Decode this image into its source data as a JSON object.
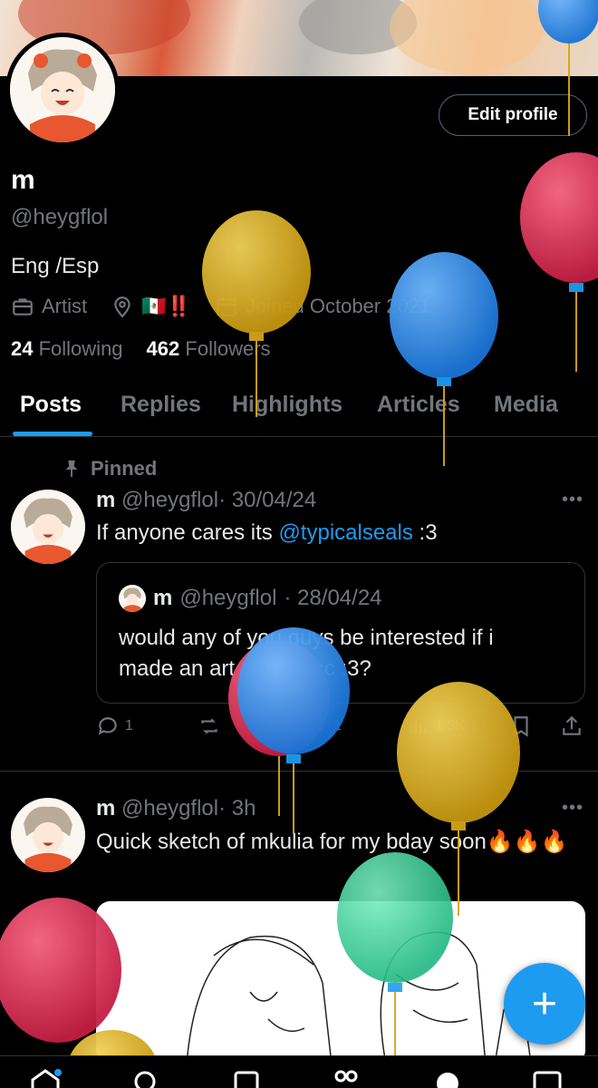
{
  "profile": {
    "display_name": "m",
    "handle": "@heygflol",
    "bio": "Eng /Esp",
    "profession": "Artist",
    "location": "🇲🇽‼️",
    "joined": "Joined October 2021",
    "following_count": "24",
    "following_label": "Following",
    "followers_count": "462",
    "followers_label": "Followers",
    "edit_button": "Edit profile"
  },
  "tabs": [
    "Posts",
    "Replies",
    "Highlights",
    "Articles",
    "Media"
  ],
  "pinned_label": "Pinned",
  "posts": [
    {
      "name": "m",
      "handle": "@heygflol",
      "time": "· 30/04/24",
      "text_before": "If anyone cares its ",
      "mention": "@typicalseals",
      "text_after": " :3",
      "quote": {
        "name": "m",
        "handle": "@heygflol",
        "time": "· 28/04/24",
        "text": "would any of you guys be interested if i made an art dump acc :3?"
      },
      "replies": "1",
      "reposts": "",
      "likes": "1",
      "views": "1.3K"
    },
    {
      "name": "m",
      "handle": "@heygflol",
      "time": "· 3h",
      "text": "Quick sketch of mkulia for my bday soon🔥🔥🔥"
    }
  ],
  "fab_label": "+",
  "colors": {
    "accent": "#1d9bf0",
    "background": "#000000",
    "muted": "#71767b",
    "border": "#2f3336"
  },
  "balloon_colors": [
    "#1d8fe8",
    "#d4a41a",
    "#e03656",
    "#31d69c"
  ]
}
